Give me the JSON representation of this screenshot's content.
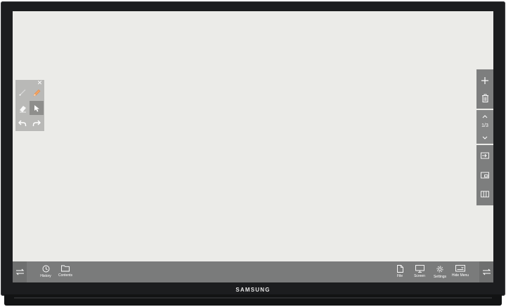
{
  "brand": "SAMSUNG",
  "palette": {
    "tools": [
      {
        "icon": "pen-thin-icon"
      },
      {
        "icon": "pencil-icon",
        "color": "#f0a060"
      },
      {
        "icon": "eraser-icon"
      },
      {
        "icon": "select-arrow-icon",
        "selected": true
      },
      {
        "icon": "undo-icon"
      },
      {
        "icon": "redo-icon"
      }
    ]
  },
  "side_toolbar": {
    "page_indicator": "1/3"
  },
  "bottom_bar": {
    "left_items": [
      {
        "label": "History",
        "icon": "clock-icon"
      },
      {
        "label": "Contents",
        "icon": "folder-icon"
      }
    ],
    "right_items": [
      {
        "label": "File",
        "icon": "file-icon"
      },
      {
        "label": "Screen",
        "icon": "monitor-icon"
      },
      {
        "label": "Settings",
        "icon": "gear-icon"
      },
      {
        "label": "Hide Menu",
        "icon": "hide-menu-icon"
      }
    ]
  },
  "colors": {
    "canvas": "#ebebe8",
    "toolbar": "#7a7b7b",
    "bezel": "#1c1d1f"
  }
}
